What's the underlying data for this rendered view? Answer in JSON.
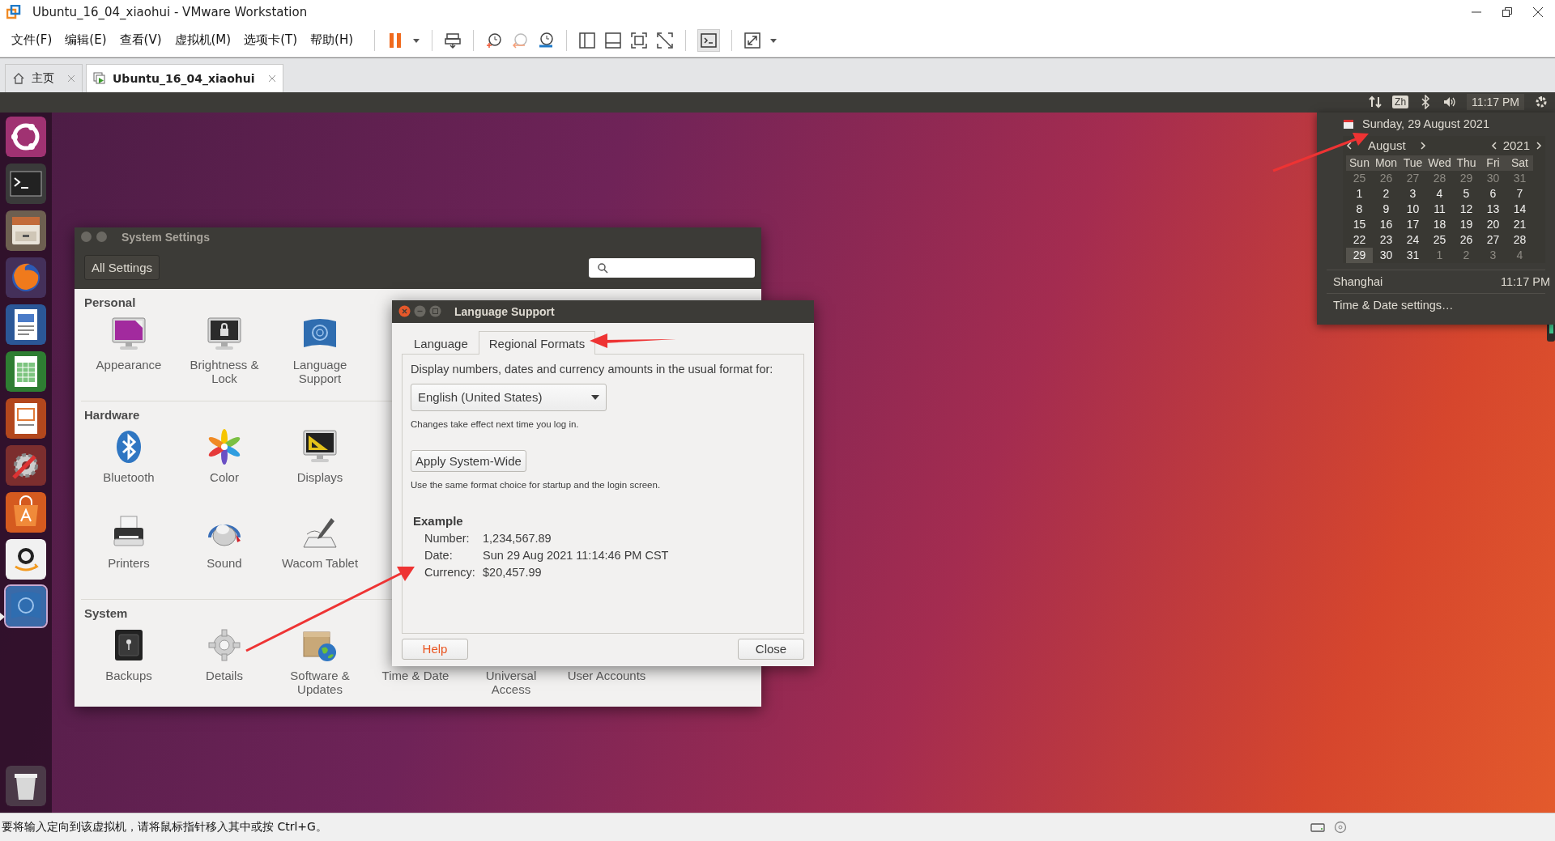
{
  "window": {
    "title": "Ubuntu_16_04_xiaohui - VMware Workstation"
  },
  "menu": [
    "文件(F)",
    "编辑(E)",
    "查看(V)",
    "虚拟机(M)",
    "选项卡(T)",
    "帮助(H)"
  ],
  "tabs": [
    {
      "label": "主页",
      "selected": false
    },
    {
      "label": "Ubuntu_16_04_xiaohui",
      "selected": true
    }
  ],
  "top_panel": {
    "keyboard": "Zh",
    "clock": "11:17 PM"
  },
  "system_settings": {
    "title": "System Settings",
    "all_settings": "All Settings",
    "sections": [
      {
        "title": "Personal",
        "rows": [
          [
            {
              "label": "Appearance",
              "kind": "appearance"
            },
            {
              "label": "Brightness & Lock",
              "kind": "brightness"
            },
            {
              "label": "Language Support",
              "kind": "language"
            }
          ]
        ]
      },
      {
        "title": "Hardware",
        "rows": [
          [
            {
              "label": "Bluetooth",
              "kind": "bluetooth"
            },
            {
              "label": "Color",
              "kind": "color"
            },
            {
              "label": "Displays",
              "kind": "displays"
            }
          ],
          [
            {
              "label": "Printers",
              "kind": "printers"
            },
            {
              "label": "Sound",
              "kind": "sound"
            },
            {
              "label": "Wacom Tablet",
              "kind": "wacom"
            }
          ]
        ]
      },
      {
        "title": "System",
        "rows": [
          [
            {
              "label": "Backups",
              "kind": "backups"
            },
            {
              "label": "Details",
              "kind": "details"
            },
            {
              "label": "Software & Updates",
              "kind": "software"
            },
            {
              "label": "Time & Date"
            },
            {
              "label": "Universal Access"
            },
            {
              "label": "User Accounts"
            }
          ]
        ]
      }
    ]
  },
  "language_support": {
    "title": "Language Support",
    "tabs": [
      {
        "label": "Language",
        "selected": false
      },
      {
        "label": "Regional Formats",
        "selected": true
      }
    ],
    "prompt": "Display numbers, dates and currency amounts in the usual format for:",
    "format": "English (United States)",
    "note": "Changes take effect next time you log in.",
    "apply_button": "Apply System-Wide",
    "apply_note": "Use the same format choice for startup and the login screen.",
    "example": {
      "heading": "Example",
      "rows": [
        {
          "label": "Number:",
          "value": "1,234,567.89"
        },
        {
          "label": "Date:",
          "value": "Sun 29 Aug 2021 11:14:46 PM CST"
        },
        {
          "label": "Currency:",
          "value": "$20,457.99"
        }
      ]
    },
    "help_button": "Help",
    "close_button": "Close"
  },
  "calendar": {
    "date_heading": "Sunday, 29 August 2021",
    "month": "August",
    "year": "2021",
    "weekdays": [
      "Sun",
      "Mon",
      "Tue",
      "Wed",
      "Thu",
      "Fri",
      "Sat"
    ],
    "days": [
      {
        "label": "25",
        "outside": true,
        "selected": false
      },
      {
        "label": "26",
        "outside": true,
        "selected": false
      },
      {
        "label": "27",
        "outside": true,
        "selected": false
      },
      {
        "label": "28",
        "outside": true,
        "selected": false
      },
      {
        "label": "29",
        "outside": true,
        "selected": false
      },
      {
        "label": "30",
        "outside": true,
        "selected": false
      },
      {
        "label": "31",
        "outside": true,
        "selected": false
      },
      {
        "label": "1",
        "outside": false,
        "selected": false
      },
      {
        "label": "2",
        "outside": false,
        "selected": false
      },
      {
        "label": "3",
        "outside": false,
        "selected": false
      },
      {
        "label": "4",
        "outside": false,
        "selected": false
      },
      {
        "label": "5",
        "outside": false,
        "selected": false
      },
      {
        "label": "6",
        "outside": false,
        "selected": false
      },
      {
        "label": "7",
        "outside": false,
        "selected": false
      },
      {
        "label": "8",
        "outside": false,
        "selected": false
      },
      {
        "label": "9",
        "outside": false,
        "selected": false
      },
      {
        "label": "10",
        "outside": false,
        "selected": false
      },
      {
        "label": "11",
        "outside": false,
        "selected": false
      },
      {
        "label": "12",
        "outside": false,
        "selected": false
      },
      {
        "label": "13",
        "outside": false,
        "selected": false
      },
      {
        "label": "14",
        "outside": false,
        "selected": false
      },
      {
        "label": "15",
        "outside": false,
        "selected": false
      },
      {
        "label": "16",
        "outside": false,
        "selected": false
      },
      {
        "label": "17",
        "outside": false,
        "selected": false
      },
      {
        "label": "18",
        "outside": false,
        "selected": false
      },
      {
        "label": "19",
        "outside": false,
        "selected": false
      },
      {
        "label": "20",
        "outside": false,
        "selected": false
      },
      {
        "label": "21",
        "outside": false,
        "selected": false
      },
      {
        "label": "22",
        "outside": false,
        "selected": false
      },
      {
        "label": "23",
        "outside": false,
        "selected": false
      },
      {
        "label": "24",
        "outside": false,
        "selected": false
      },
      {
        "label": "25",
        "outside": false,
        "selected": false
      },
      {
        "label": "26",
        "outside": false,
        "selected": false
      },
      {
        "label": "27",
        "outside": false,
        "selected": false
      },
      {
        "label": "28",
        "outside": false,
        "selected": false
      },
      {
        "label": "29",
        "outside": false,
        "selected": true
      },
      {
        "label": "30",
        "outside": false,
        "selected": false
      },
      {
        "label": "31",
        "outside": false,
        "selected": false
      },
      {
        "label": "1",
        "outside": true,
        "selected": false
      },
      {
        "label": "2",
        "outside": true,
        "selected": false
      },
      {
        "label": "3",
        "outside": true,
        "selected": false
      },
      {
        "label": "4",
        "outside": true,
        "selected": false
      }
    ],
    "location": "Shanghai",
    "location_time": "11:17 PM",
    "settings_link": "Time & Date settings…"
  },
  "status_bar": {
    "message": "要将输入定向到该虚拟机，请将鼠标指针移入其中或按 Ctrl+G。"
  }
}
